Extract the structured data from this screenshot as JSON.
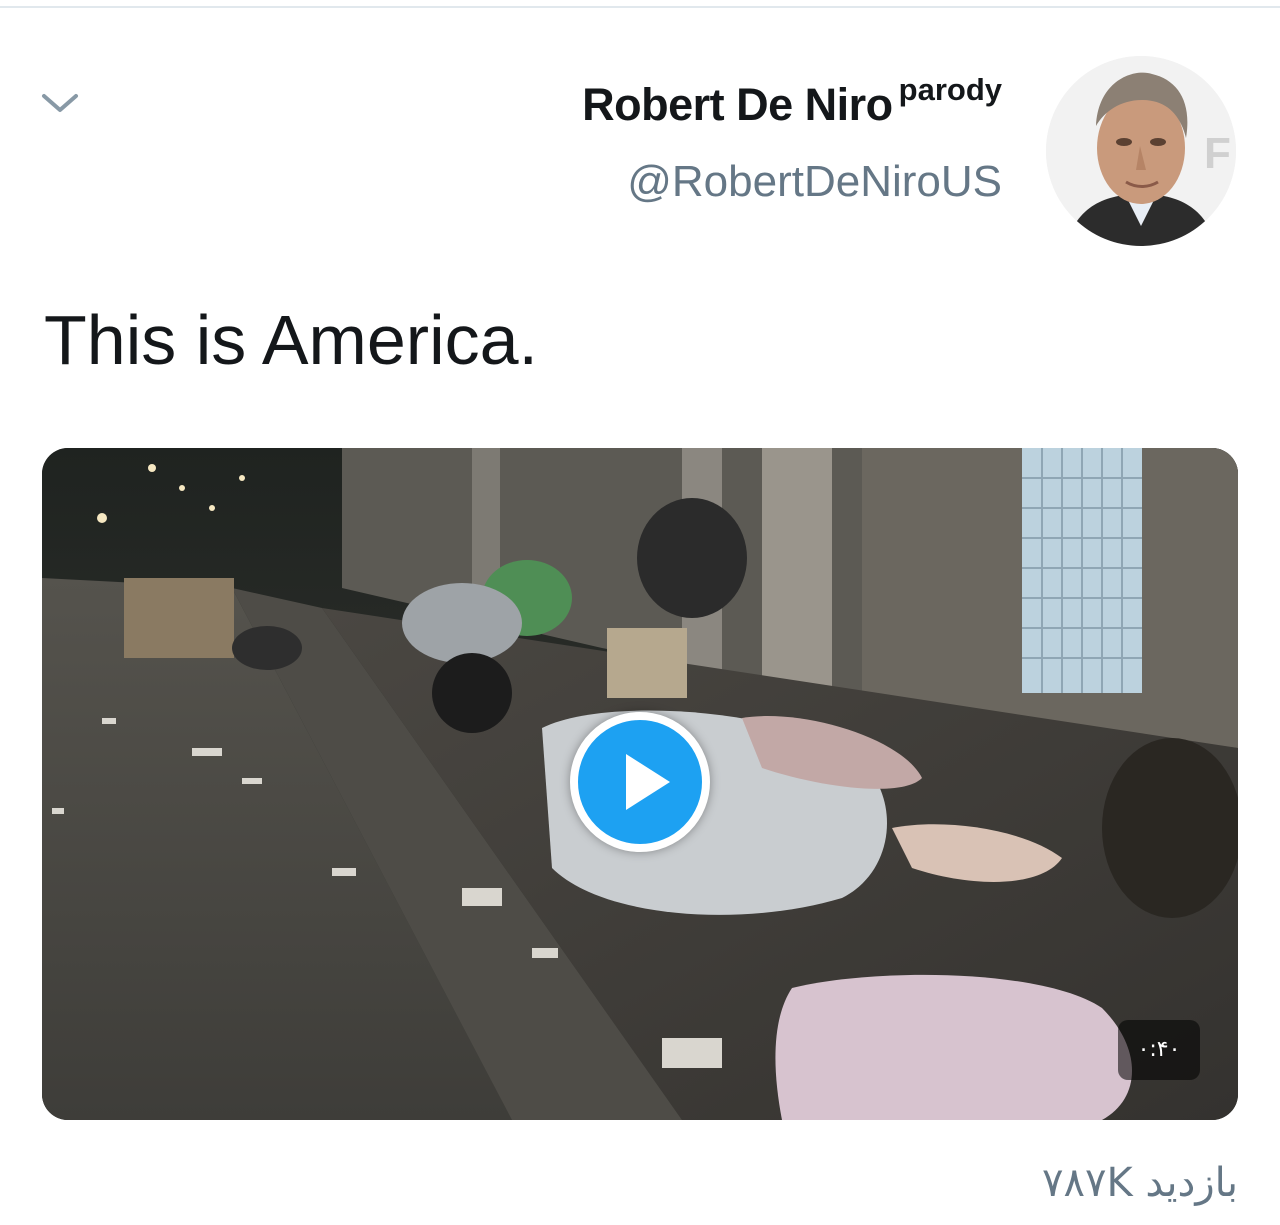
{
  "tweet": {
    "author": {
      "display_name": "Robert De Niro",
      "badge": "parody",
      "handle": "@RobertDeNiroUS",
      "avatar_icon": "profile-photo"
    },
    "menu_icon": "chevron-down-icon",
    "text": "This is America.",
    "media": {
      "type": "video",
      "play_icon": "play-icon",
      "duration": "۰:۴۰"
    },
    "view_count": "۷۸۷K بازدید"
  },
  "colors": {
    "text_primary": "#14171a",
    "text_secondary": "#657786",
    "accent": "#1da1f2",
    "divider": "#e1e8ed"
  }
}
